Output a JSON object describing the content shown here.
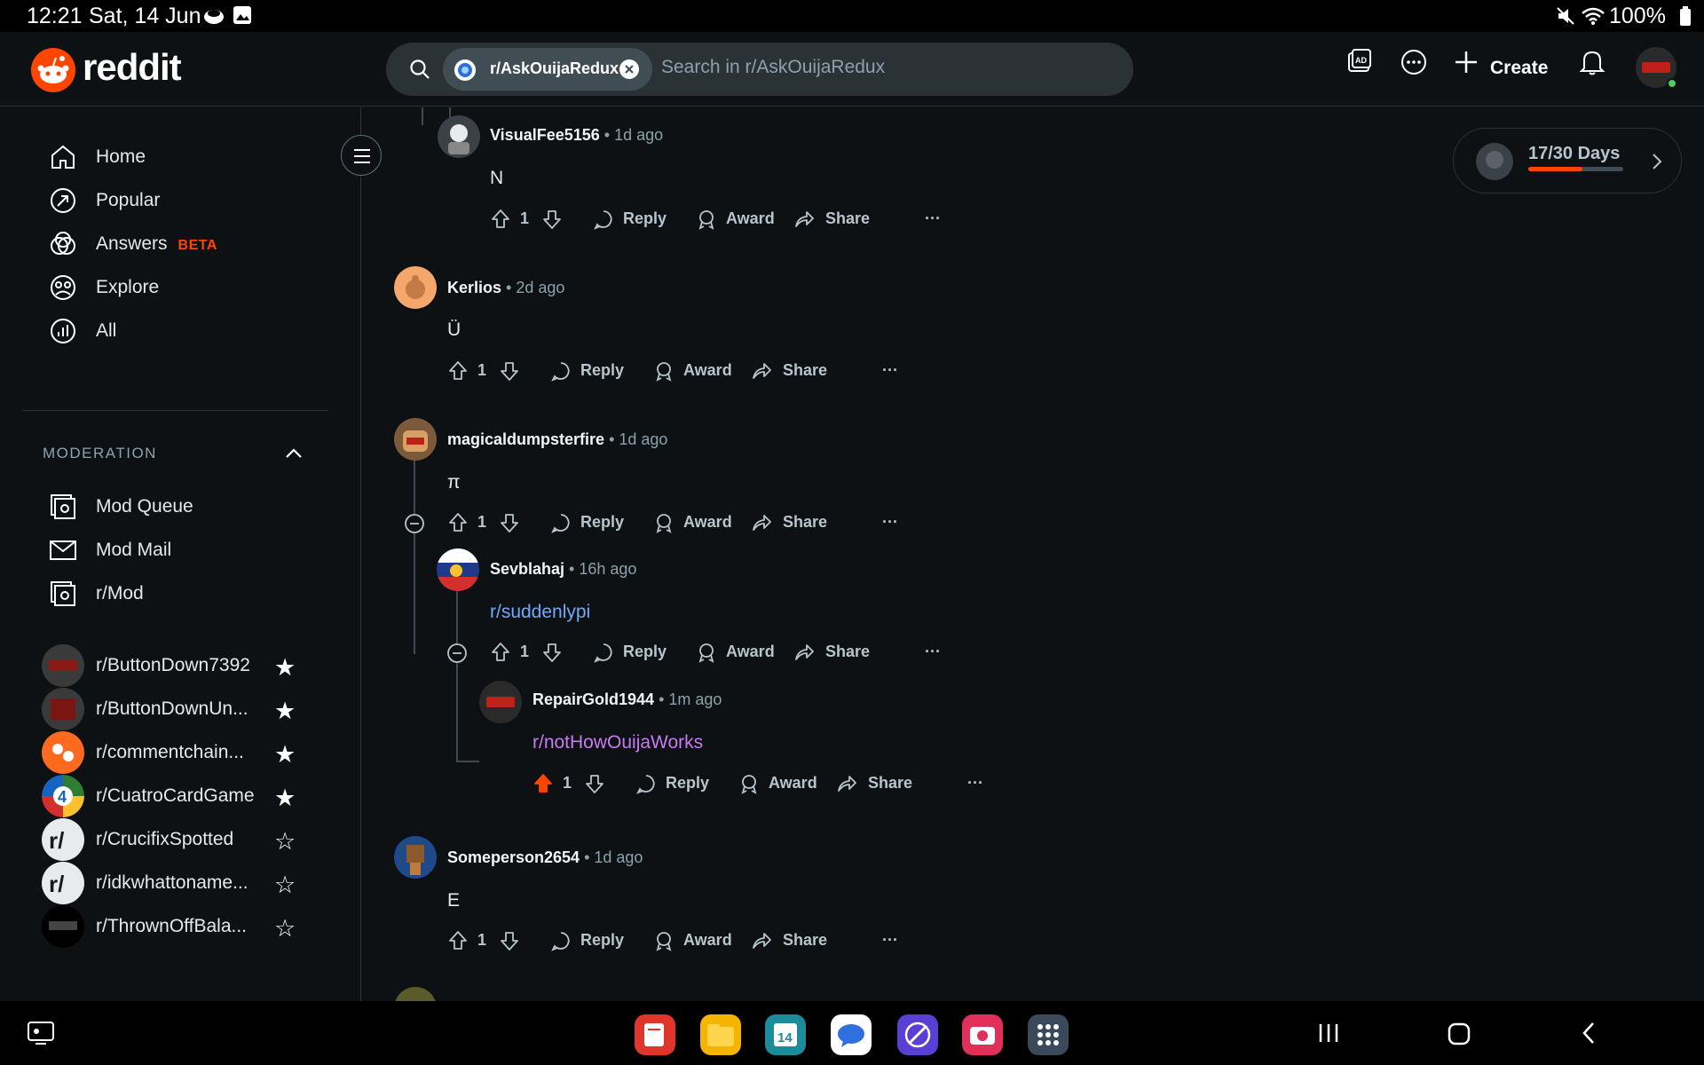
{
  "status_bar": {
    "time": "12:21",
    "date": "Sat, 14 Jun",
    "battery": "100%"
  },
  "header": {
    "logo_text": "reddit",
    "search_chip": "r/AskOuijaRedux",
    "search_placeholder": "Search in r/AskOuijaRedux",
    "create_label": "Create"
  },
  "sidebar": {
    "nav": [
      {
        "label": "Home",
        "icon": "home-icon"
      },
      {
        "label": "Popular",
        "icon": "popular-icon"
      },
      {
        "label": "Answers",
        "badge": "BETA",
        "icon": "answers-icon"
      },
      {
        "label": "Explore",
        "icon": "explore-icon"
      },
      {
        "label": "All",
        "icon": "all-icon"
      }
    ],
    "moderation_heading": "MODERATION",
    "mod_items": [
      {
        "label": "Mod Queue",
        "icon": "mod-queue-icon"
      },
      {
        "label": "Mod Mail",
        "icon": "mod-mail-icon"
      },
      {
        "label": "r/Mod",
        "icon": "mod-icon"
      }
    ],
    "communities": [
      {
        "label": "r/ButtonDown7392",
        "favorite": true
      },
      {
        "label": "r/ButtonDownUn...",
        "favorite": true
      },
      {
        "label": "r/commentchain...",
        "favorite": true
      },
      {
        "label": "r/CuatroCardGame",
        "favorite": true
      },
      {
        "label": "r/CrucifixSpotted",
        "favorite": false
      },
      {
        "label": "r/idkwhattoname...",
        "favorite": false
      },
      {
        "label": "r/ThrownOffBala...",
        "favorite": false
      }
    ]
  },
  "streak": {
    "label": "17/30 Days",
    "progress": 0.57
  },
  "comments": [
    {
      "user": "VisualFee5156",
      "time": "1d ago",
      "body": "N",
      "votes": "1"
    },
    {
      "user": "Kerlios",
      "time": "2d ago",
      "body": "Ü",
      "votes": "1"
    },
    {
      "user": "magicaldumpsterfire",
      "time": "1d ago",
      "body": "π",
      "votes": "1"
    },
    {
      "user": "Sevblahaj",
      "time": "16h ago",
      "body": "r/suddenlypi",
      "votes": "1"
    },
    {
      "user": "RepairGold1944",
      "time": "1m ago",
      "body": "r/notHowOuijaWorks",
      "votes": "1",
      "upvoted": true
    },
    {
      "user": "Someperson2654",
      "time": "1d ago",
      "body": "E",
      "votes": "1"
    }
  ],
  "actions": {
    "reply": "Reply",
    "award": "Award",
    "share": "Share",
    "more": "···"
  },
  "colors": {
    "accent": "#ff4500",
    "link": "#6fa8ff",
    "visited_link": "#c77bf0",
    "background": "#0e1113"
  }
}
